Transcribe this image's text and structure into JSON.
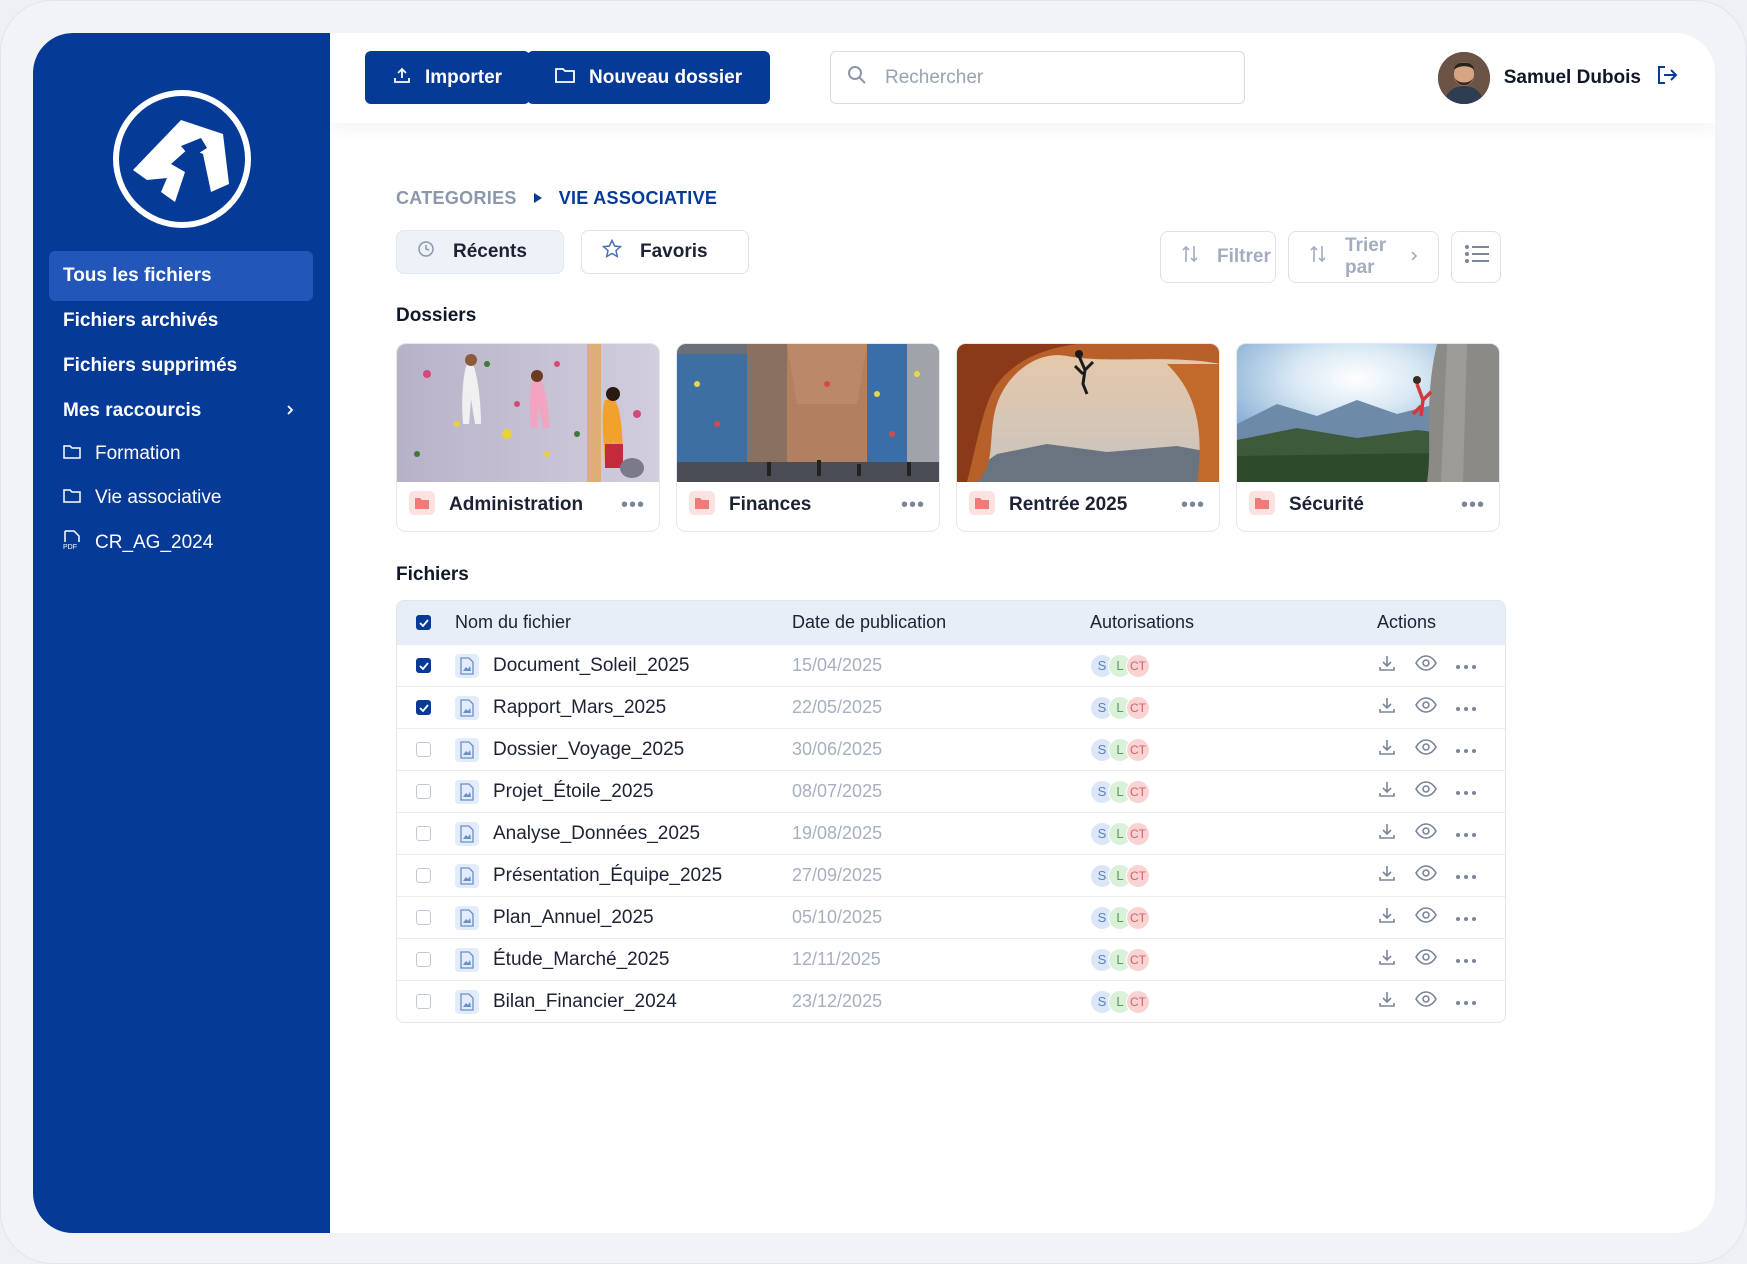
{
  "sidebar": {
    "items": [
      {
        "label": "Tous les fichiers"
      },
      {
        "label": "Fichiers archivés"
      },
      {
        "label": "Fichiers supprimés"
      },
      {
        "label": "Mes raccourcis"
      }
    ],
    "shortcuts": [
      {
        "label": "Formation",
        "icon": "folder-icon"
      },
      {
        "label": "Vie associative",
        "icon": "folder-icon"
      },
      {
        "label": "CR_AG_2024",
        "icon": "pdf-file-icon"
      }
    ]
  },
  "toolbar": {
    "import_label": "Importer",
    "new_folder_label": "Nouveau dossier",
    "search_placeholder": "Rechercher"
  },
  "user": {
    "name": "Samuel Dubois"
  },
  "breadcrumb": {
    "root": "CATEGORIES",
    "current": "VIE ASSOCIATIVE"
  },
  "filters": {
    "recents": "Récents",
    "favoris": "Favoris",
    "filtrer": "Filtrer",
    "trier": "Trier par"
  },
  "sections": {
    "folders": "Dossiers",
    "files": "Fichiers"
  },
  "folders": [
    {
      "name": "Administration"
    },
    {
      "name": "Finances"
    },
    {
      "name": "Rentrée 2025"
    },
    {
      "name": "Sécurité"
    }
  ],
  "table": {
    "headers": {
      "name": "Nom du fichier",
      "date": "Date de publication",
      "auth": "Autorisations",
      "actions": "Actions"
    },
    "rows": [
      {
        "name": "Document_Soleil_2025",
        "date": "15/04/2025",
        "checked": true
      },
      {
        "name": "Rapport_Mars_2025",
        "date": "22/05/2025",
        "checked": true
      },
      {
        "name": "Dossier_Voyage_2025",
        "date": "30/06/2025",
        "checked": false
      },
      {
        "name": "Projet_Étoile_2025",
        "date": "08/07/2025",
        "checked": false
      },
      {
        "name": "Analyse_Données_2025",
        "date": "19/08/2025",
        "checked": false
      },
      {
        "name": "Présentation_Équipe_2025",
        "date": "27/09/2025",
        "checked": false
      },
      {
        "name": "Plan_Annuel_2025",
        "date": "05/10/2025",
        "checked": false
      },
      {
        "name": "Étude_Marché_2025",
        "date": "12/11/2025",
        "checked": false
      },
      {
        "name": "Bilan_Financier_2024",
        "date": "23/12/2025",
        "checked": false
      }
    ],
    "auth_chips": [
      "S",
      "L",
      "CT"
    ]
  },
  "colors": {
    "brand": "#063a97",
    "active_nav": "#2256b8",
    "folder_icon": "#f4a3a3"
  }
}
